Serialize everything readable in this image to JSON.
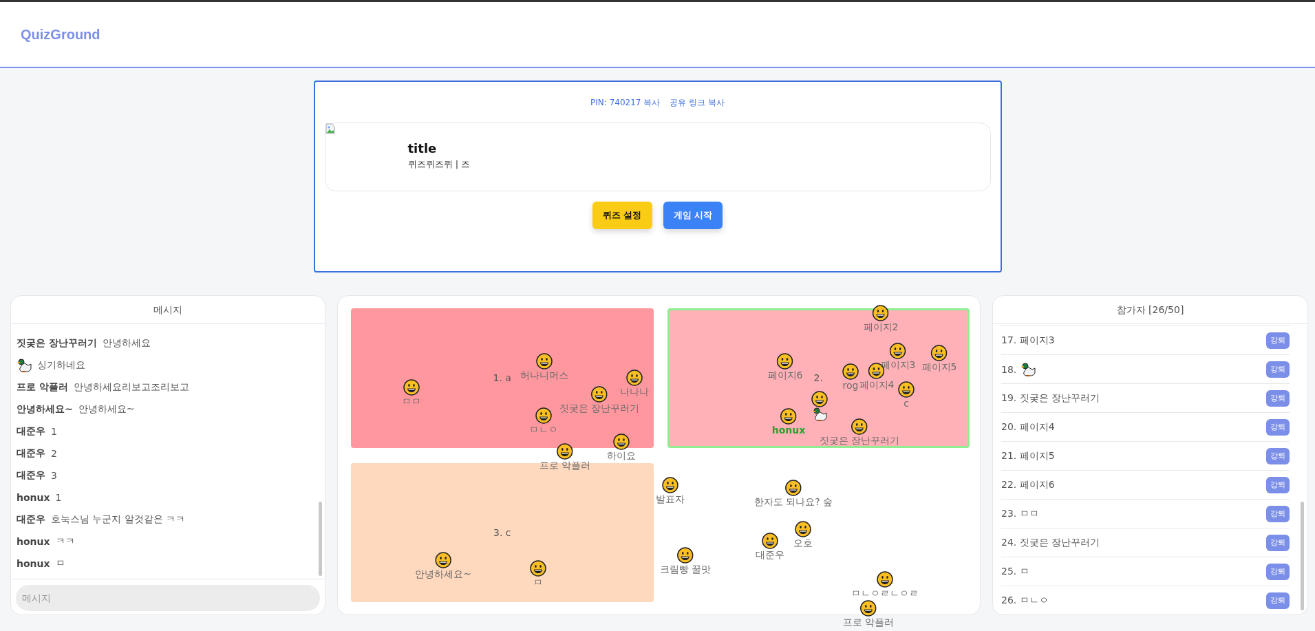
{
  "app": {
    "logo": "QuizGround"
  },
  "room": {
    "pin_link": "PIN: 740217 복사",
    "share_link": "공유 링크 복사"
  },
  "quiz": {
    "title": "title",
    "description": "퀴즈퀴즈퀴 | 즈"
  },
  "buttons": [
    {
      "label": "퀴즈 설정",
      "kind": "settings"
    },
    {
      "label": "게임 시작",
      "kind": "start"
    }
  ],
  "chat": {
    "title": "메시지",
    "messages": [
      {
        "kind": "name",
        "sender": "짓궂은 장난꾸러기",
        "text": "안녕하세요"
      },
      {
        "kind": "duck",
        "text": "싱기하네요"
      },
      {
        "kind": "name",
        "sender": "프로 악플러",
        "text": "안녕하세요리보고조리보고"
      },
      {
        "kind": "name",
        "sender": "안녕하세요~",
        "text": "안녕하세요~"
      },
      {
        "kind": "name",
        "sender": "대준우",
        "text": "1"
      },
      {
        "kind": "name",
        "sender": "대준우",
        "text": "2"
      },
      {
        "kind": "name",
        "sender": "대준우",
        "text": "3"
      },
      {
        "kind": "name",
        "sender": "honux",
        "text": "1"
      },
      {
        "kind": "name",
        "sender": "대준우",
        "text": "호눅스님 누군지 알것같은 ㅋㅋ"
      },
      {
        "kind": "name",
        "sender": "honux",
        "text": "ㅋㅋ"
      },
      {
        "kind": "name",
        "sender": "honux",
        "text": "ㅁ"
      }
    ],
    "input": {
      "placeholder": "메시지"
    }
  },
  "board": {
    "options": [
      {
        "label": "1. a",
        "color": "#ff979f",
        "selected": false
      },
      {
        "label": "2.",
        "color": "#ffb1b7",
        "selected": true
      },
      {
        "label": "3. c",
        "color": "#fed9be",
        "selected": false
      }
    ],
    "players": [
      {
        "kind": "name",
        "name": "허나니머스",
        "me": false
      },
      {
        "kind": "name",
        "name": "ㅁㅁ",
        "me": false
      },
      {
        "kind": "name",
        "name": "나나나",
        "me": false
      },
      {
        "kind": "name",
        "name": "짓궂은 장난꾸러기",
        "me": false
      },
      {
        "kind": "name",
        "name": "ㅁㄴㅇ",
        "me": false
      },
      {
        "kind": "name",
        "name": "프로 악플러",
        "me": false
      },
      {
        "kind": "name",
        "name": "하이요",
        "me": false
      },
      {
        "kind": "name",
        "name": "안녕하세요~",
        "me": false
      },
      {
        "kind": "name",
        "name": "ㅁ",
        "me": false
      },
      {
        "kind": "name",
        "name": "크림빵 꿀맛",
        "me": false
      },
      {
        "kind": "name",
        "name": "페이지2",
        "me": false
      },
      {
        "kind": "name",
        "name": "페이지3",
        "me": false
      },
      {
        "kind": "name",
        "name": "페이지5",
        "me": false
      },
      {
        "kind": "name",
        "name": "페이지6",
        "me": false
      },
      {
        "kind": "name",
        "name": "rog",
        "me": false
      },
      {
        "kind": "name",
        "name": "페이지4",
        "me": false
      },
      {
        "kind": "name",
        "name": "c",
        "me": false
      },
      {
        "kind": "duck"
      },
      {
        "kind": "name",
        "name": "honux",
        "me": true
      },
      {
        "kind": "name",
        "name": "짓궂은 장난꾸러기",
        "me": false
      },
      {
        "kind": "name",
        "name": "발표자",
        "me": false
      },
      {
        "kind": "name",
        "name": "한자도 되나요? 숲",
        "me": false
      },
      {
        "kind": "name",
        "name": "오호",
        "me": false
      },
      {
        "kind": "name",
        "name": "대준우",
        "me": false
      },
      {
        "kind": "name",
        "name": "ㅁㄴㅇㄹㄴㅇㄹ",
        "me": false
      },
      {
        "kind": "name",
        "name": "프로 악플러",
        "me": false
      }
    ]
  },
  "participants": {
    "title": "참가자 [26/50]",
    "items": [
      {
        "kind": "name",
        "label": "17. 페이지3",
        "action": "강퇴"
      },
      {
        "kind": "duck",
        "label": "18.",
        "action": "강퇴"
      },
      {
        "kind": "name",
        "label": "19. 짓궂은 장난꾸러기",
        "action": "강퇴"
      },
      {
        "kind": "name",
        "label": "20. 페이지4",
        "action": "강퇴"
      },
      {
        "kind": "name",
        "label": "21. 페이지5",
        "action": "강퇴"
      },
      {
        "kind": "name",
        "label": "22. 페이지6",
        "action": "강퇴"
      },
      {
        "kind": "name",
        "label": "23. ㅁㅁ",
        "action": "강퇴"
      },
      {
        "kind": "name",
        "label": "24. 짓궂은 장난꾸러기",
        "action": "강퇴"
      },
      {
        "kind": "name",
        "label": "25. ㅁ",
        "action": "강퇴"
      },
      {
        "kind": "name",
        "label": "26. ㅁㄴㅇ",
        "action": "강퇴"
      }
    ]
  }
}
